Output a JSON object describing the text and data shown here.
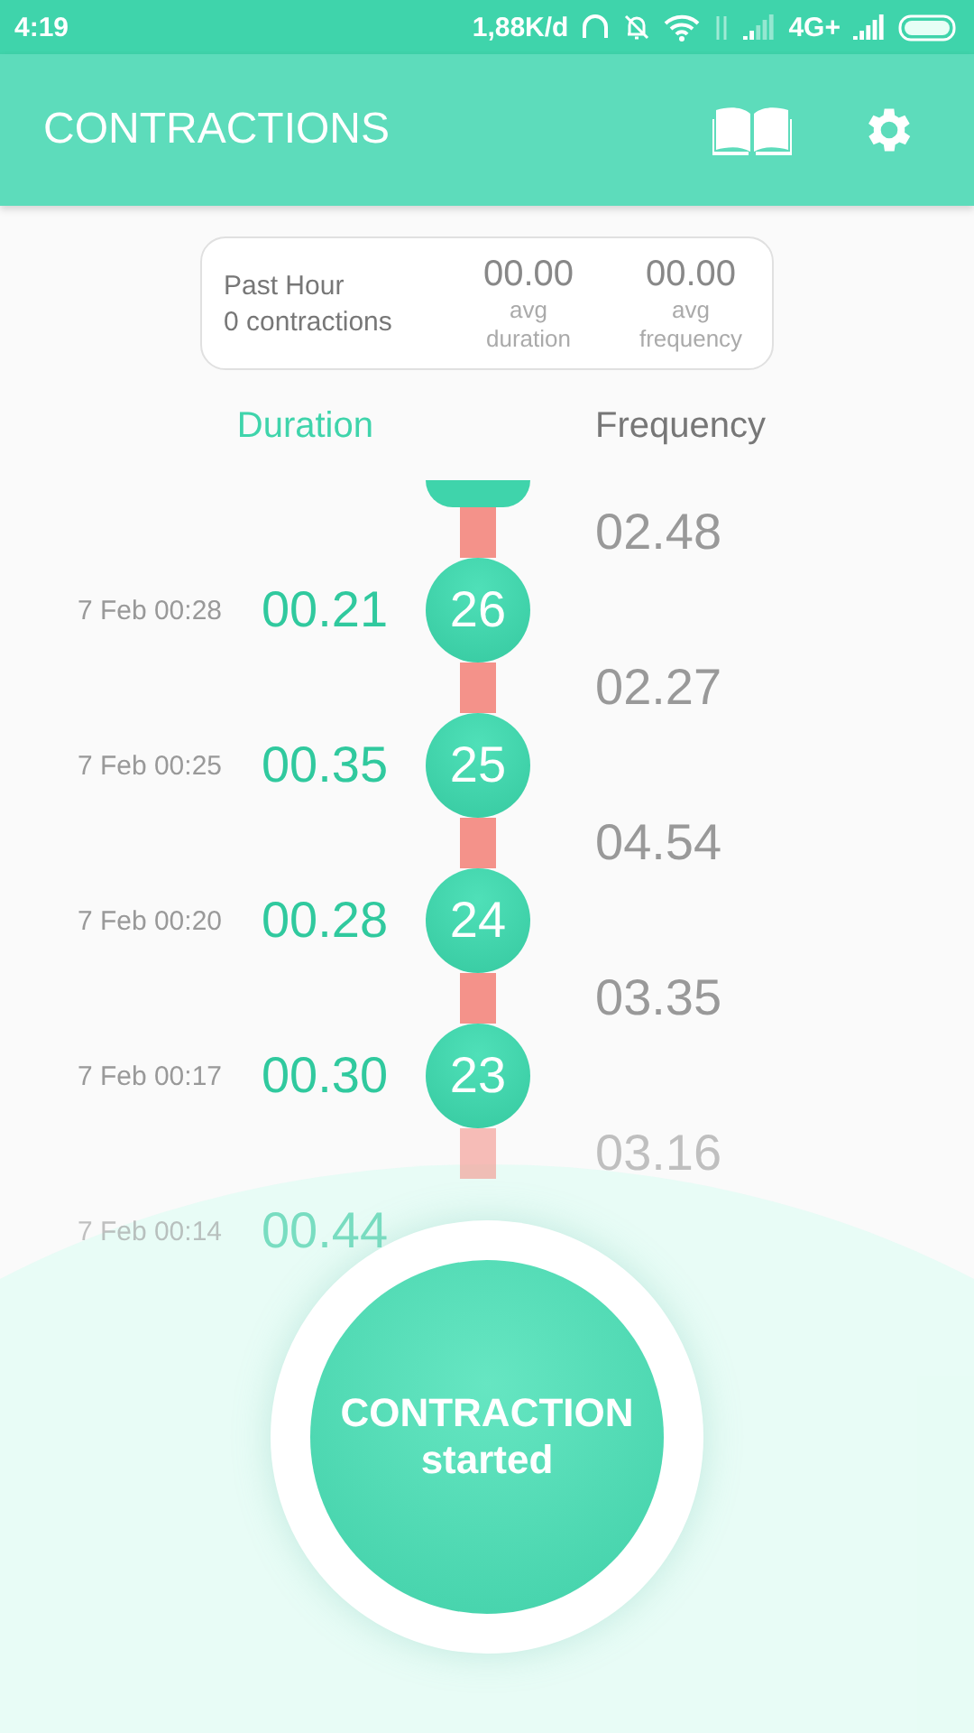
{
  "status_bar": {
    "time": "4:19",
    "speed": "1,88K/d",
    "network": "4G+"
  },
  "app_bar": {
    "title": "CONTRACTIONS"
  },
  "summary": {
    "period": "Past Hour",
    "count": "0 contractions",
    "stats": [
      {
        "value": "00.00",
        "label": "avg duration"
      },
      {
        "value": "00.00",
        "label": "avg frequency"
      }
    ]
  },
  "columns": [
    {
      "label": "Duration",
      "selected": true
    },
    {
      "label": "Frequency",
      "selected": false
    }
  ],
  "rows": [
    {
      "frequency": "02.48",
      "date": "7 Feb 00:28",
      "duration": "00.21",
      "number": "26",
      "faded": false
    },
    {
      "frequency": "02.27",
      "date": "7 Feb 00:25",
      "duration": "00.35",
      "number": "25",
      "faded": false
    },
    {
      "frequency": "04.54",
      "date": "7 Feb 00:20",
      "duration": "00.28",
      "number": "24",
      "faded": false
    },
    {
      "frequency": "03.35",
      "date": "7 Feb 00:17",
      "duration": "00.30",
      "number": "23",
      "faded": false
    },
    {
      "frequency": "03.16",
      "date": "7 Feb 00:14",
      "duration": "00.44",
      "faded": true
    }
  ],
  "action_button": {
    "title": "CONTRACTION",
    "subtitle": "started"
  }
}
